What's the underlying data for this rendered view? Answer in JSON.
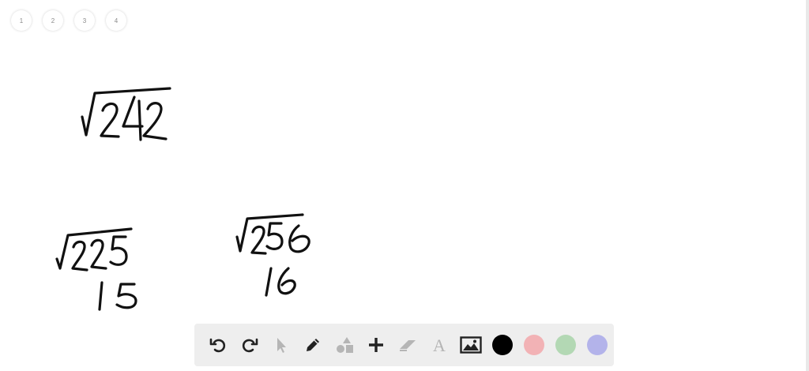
{
  "pages": [
    "1",
    "2",
    "3",
    "4"
  ],
  "toolbar": {
    "tools": [
      "undo-icon",
      "redo-icon",
      "select-icon",
      "pen-icon",
      "shapes-icon",
      "add-icon",
      "eraser-icon",
      "text-icon",
      "image-icon"
    ],
    "text_tool_glyph": "A",
    "colors": [
      "#000000",
      "#f2b2b5",
      "#b3d8b4",
      "#b3b3ea"
    ],
    "selected_color": "#000000"
  },
  "handwriting": [
    "√242",
    "√225",
    "15",
    "√256",
    "16"
  ]
}
